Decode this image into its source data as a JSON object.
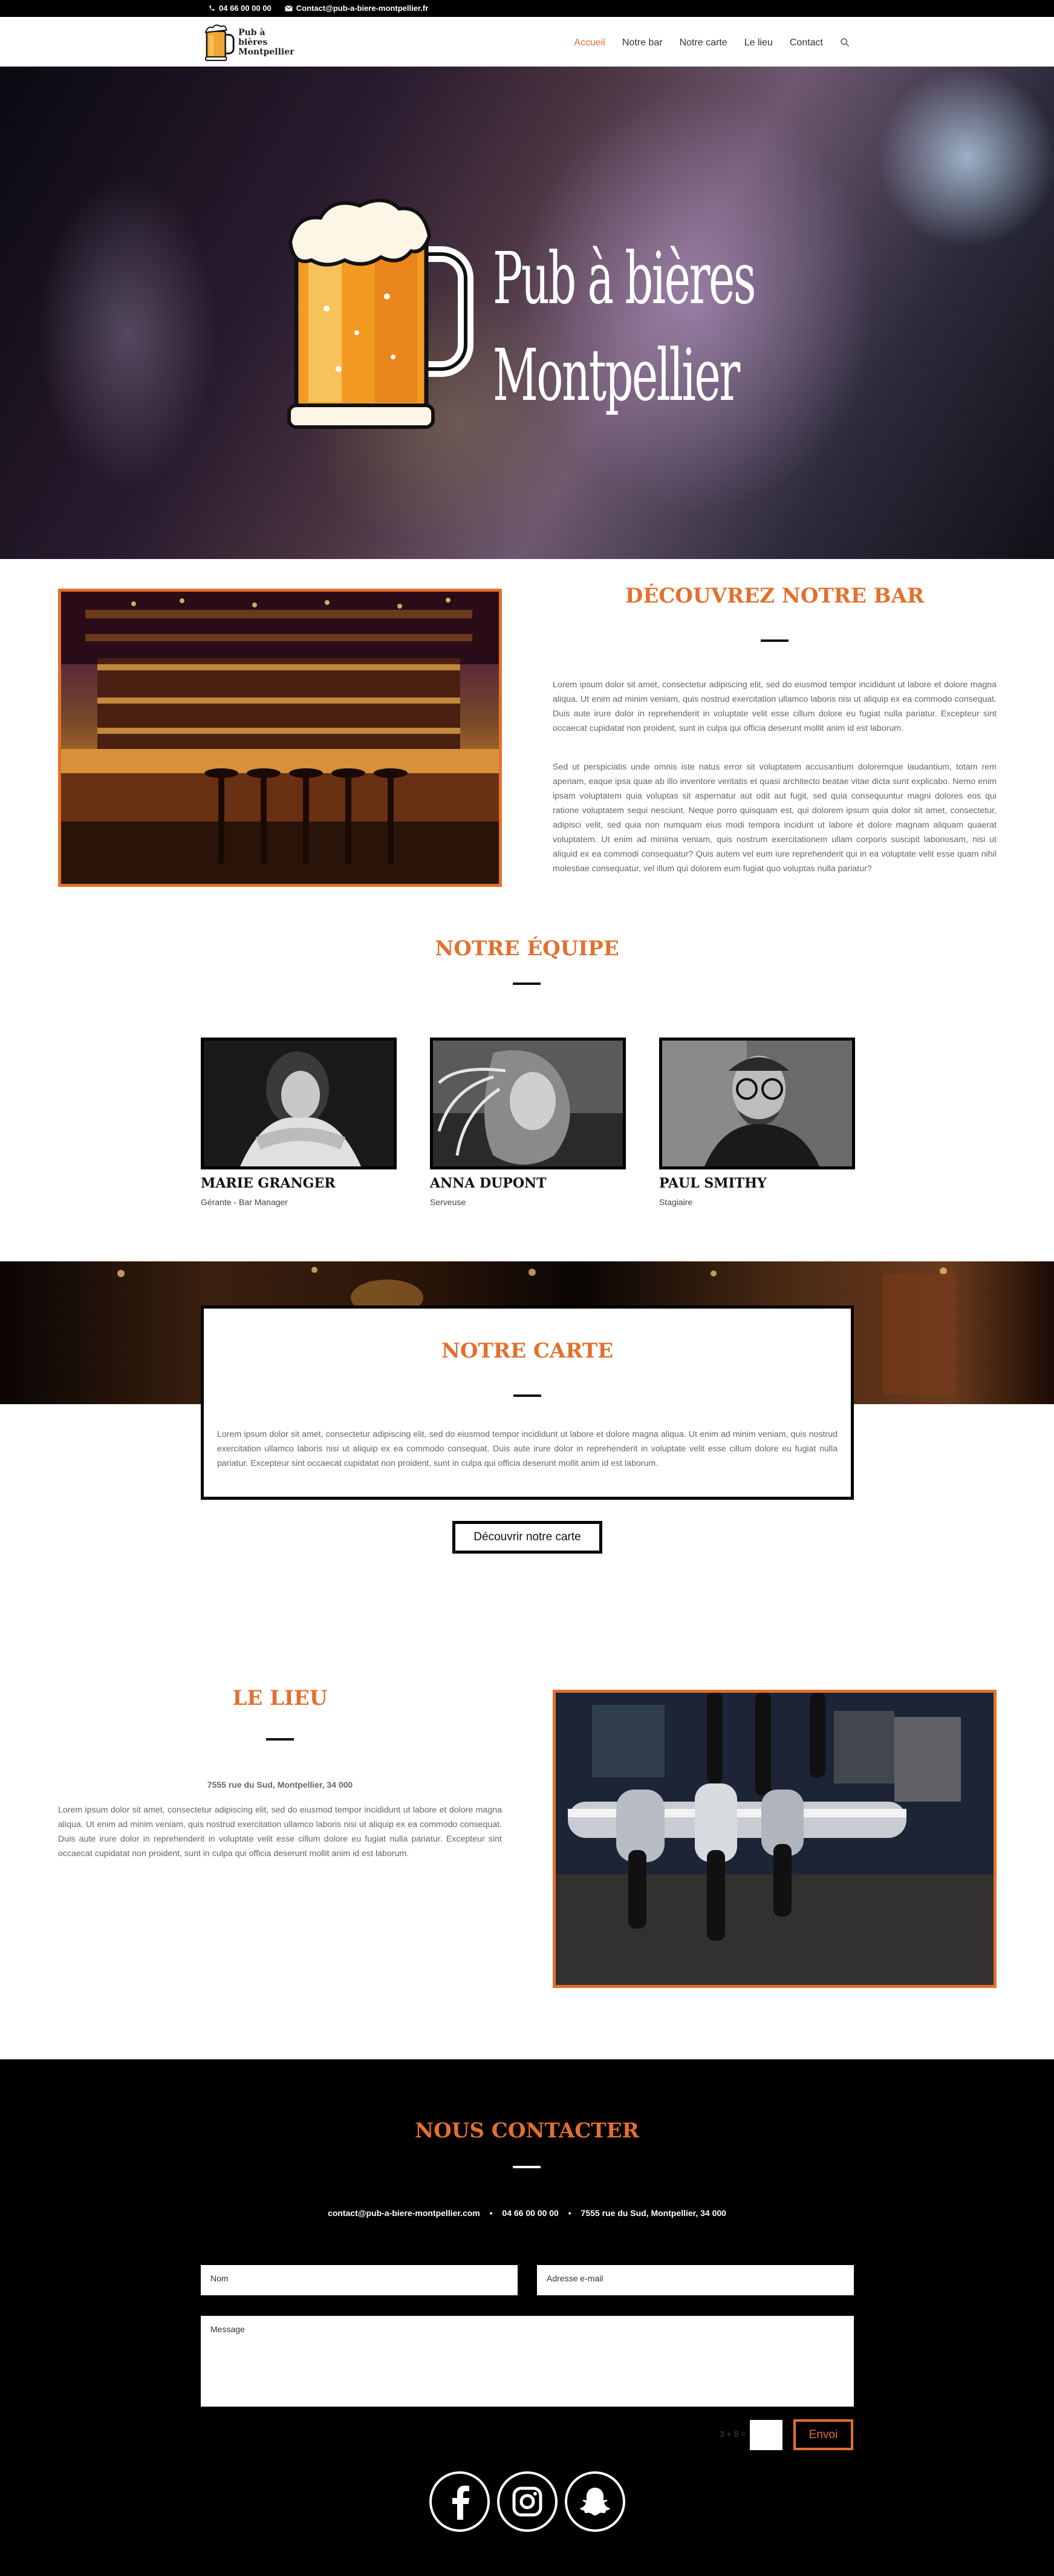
{
  "topbar": {
    "phone": "04 66 00 00 00",
    "email": "Contact@pub-a-biere-montpellier.fr"
  },
  "logo": {
    "line1": "Pub à bières",
    "line2": "Montpellier"
  },
  "nav": {
    "items": [
      {
        "label": "Accueil",
        "active": true
      },
      {
        "label": "Notre bar",
        "active": false
      },
      {
        "label": "Notre carte",
        "active": false
      },
      {
        "label": "Le lieu",
        "active": false
      },
      {
        "label": "Contact",
        "active": false
      }
    ],
    "search_icon": "search-icon"
  },
  "hero": {
    "title_line1": "Pub à bières",
    "title_line2": "Montpellier"
  },
  "bar_section": {
    "heading": "DÉCOUVREZ NOTRE BAR",
    "paragraph1": "Lorem ipsum dolor sit amet, consectetur adipiscing elit, sed do eiusmod tempor incididunt ut labore et dolore magna aliqua. Ut enim ad minim veniam, quis nostrud exercitation ullamco laboris nisi ut aliquip ex ea commodo consequat. Duis aute irure dolor in reprehenderit in voluptate velit esse cillum dolore eu fugiat nulla pariatur. Excepteur sint occaecat cupidatat non proident, sunt in culpa qui officia deserunt mollit anim id est laborum.",
    "paragraph2": "Sed ut perspiciatis unde omnis iste natus error sit voluptatem accusantium doloremque laudantium, totam rem aperiam, eaque ipsa quae ab illo inventore veritatis et quasi architecto beatae vitae dicta sunt explicabo. Nemo enim ipsam voluptatem quia voluptas sit aspernatur aut odit aut fugit, sed quia consequuntur magni dolores eos qui ratione voluptatem sequi nesciunt. Neque porro quisquam est, qui dolorem ipsum quia dolor sit amet, consectetur, adipisci velit, sed quia non numquam eius modi tempora incidunt ut labore et dolore magnam aliquam quaerat voluptatem. Ut enim ad minima veniam, quis nostrum exercitationem ullam corporis suscipit laboriosam, nisi ut aliquid ex ea commodi consequatur? Quis autem vel eum iure reprehenderit qui in ea voluptate velit esse quam nihil molestiae consequatur, vel illum qui dolorem eum fugiat quo voluptas nulla pariatur?"
  },
  "team": {
    "heading": "NOTRE ÉQUIPE",
    "members": [
      {
        "name": "MARIE GRANGER",
        "role": "Gérante - Bar Manager"
      },
      {
        "name": "ANNA DUPONT",
        "role": "Serveuse"
      },
      {
        "name": "PAUL SMITHY",
        "role": "Stagiaire"
      }
    ]
  },
  "carte": {
    "heading": "NOTRE CARTE",
    "paragraph": "Lorem ipsum dolor sit amet, consectetur adipiscing elit, sed do eiusmod tempor incididunt ut labore et dolore magna aliqua. Ut enim ad minim veniam, quis nostrud exercitation ullamco laboris nisi ut aliquip ex ea commodo consequat. Duis aute irure dolor in reprehenderit in voluptate velit esse cillum dolore eu fugiat nulla pariatur. Excepteur sint occaecat cupidatat non proident, sunt in culpa qui officia deserunt mollit anim id est laborum.",
    "button": "Découvrir notre carte"
  },
  "lieu": {
    "heading": "LE LIEU",
    "address": "7555 rue du Sud, Montpellier, 34 000",
    "paragraph": "Lorem ipsum dolor sit amet, consectetur adipiscing elit, sed do eiusmod tempor incididunt ut labore et dolore magna aliqua. Ut enim ad minim veniam, quis nostrud exercitation ullamco laboris nisi ut aliquip ex ea commodo consequat. Duis aute irure dolor in reprehenderit in voluptate velit esse cillum dolore eu fugiat nulla pariatur. Excepteur sint occaecat cupidatat non proident, sunt in culpa qui officia deserunt mollit anim id est laborum."
  },
  "contact": {
    "heading": "NOUS CONTACTER",
    "email": "contact@pub-a-biere-montpellier.com",
    "phone": "04 66 00 00 00",
    "address": "7555 rue du Sud, Montpellier, 34 000",
    "separator": "•",
    "name_placeholder": "Nom",
    "email_placeholder": "Adresse e-mail",
    "message_placeholder": "Message",
    "captcha": "3 + 8 =",
    "submit": "Envoi"
  },
  "social": [
    "facebook-icon",
    "instagram-icon",
    "snapchat-icon"
  ],
  "colors": {
    "accent": "#e3702d",
    "dark": "#000000"
  }
}
